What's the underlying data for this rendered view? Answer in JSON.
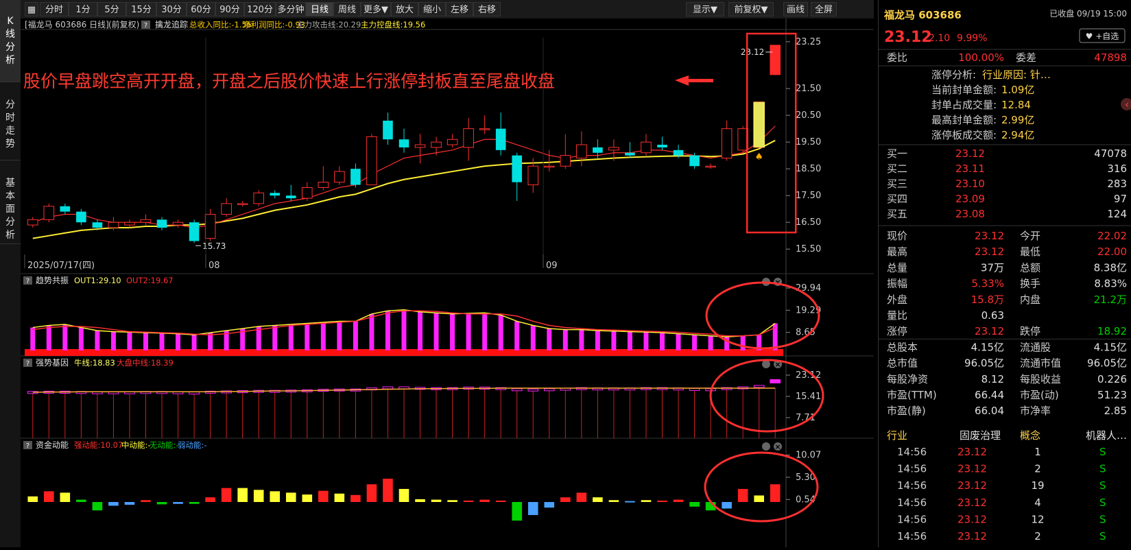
{
  "left_tabs": [
    {
      "label": [
        "K",
        "线",
        "分",
        "析"
      ],
      "active": true
    },
    {
      "label": [
        "分",
        "时",
        "走",
        "势"
      ],
      "active": false
    },
    {
      "label": [
        "基",
        "本",
        "面",
        "分",
        "析"
      ],
      "active": false
    }
  ],
  "toolbar": {
    "periods": [
      "分时",
      "1分",
      "5分",
      "15分",
      "30分",
      "60分",
      "90分",
      "120分",
      "多分钟",
      "日线",
      "周线",
      "更多▼"
    ],
    "active_period": "日线",
    "actions": [
      "放大",
      "缩小",
      "左移",
      "右移"
    ],
    "right": [
      "显示▼",
      "前复权▼",
      "画线",
      "全屏"
    ]
  },
  "main_header": {
    "title": "[福龙马 603686 日线]",
    "adjust": "(前复权)",
    "help": "?",
    "indicator_name": "擒龙追踪",
    "items": [
      {
        "text": "总收入同比:-1.55",
        "color": "#ffcc00"
      },
      {
        "text": "净利润同比:-0.93",
        "color": "#ffcc00"
      },
      {
        "text": "主力攻击线:20.29",
        "color": "#aaaaaa"
      },
      {
        "text": "主力控盘线:19.56",
        "color": "#ffee33"
      }
    ]
  },
  "annotation": {
    "text": "股价早盘跳空高开开盘，开盘之后股价快速上行涨停封板直至尾盘收盘",
    "color": "#ff3b30"
  },
  "price_axis": [
    "23.25",
    "21.50",
    "20.50",
    "19.50",
    "18.50",
    "17.50",
    "16.50",
    "15.50"
  ],
  "price_marks": {
    "high_label": "23.12",
    "low_label": "15.73"
  },
  "x_axis": [
    "2025/07/17(四)",
    "08",
    "09"
  ],
  "sub1": {
    "help": "?",
    "name": "趋势共振",
    "items": [
      {
        "text": "OUT1:29.10",
        "color": "#ffff66"
      },
      {
        "text": "OUT2:19.67",
        "color": "#ff3030"
      }
    ],
    "axis": [
      "29.94",
      "19.29",
      "8.65"
    ]
  },
  "sub2": {
    "help": "?",
    "name": "强势基因",
    "items": [
      {
        "text": "牛线:18.83",
        "color": "#ffff66"
      },
      {
        "text": "大盘中线:18.39",
        "color": "#ff3030"
      }
    ],
    "axis": [
      "23.12",
      "15.41",
      "7.71"
    ]
  },
  "sub3": {
    "help": "?",
    "name": "资金动能",
    "items": [
      {
        "text": "强动能:10.07",
        "color": "#ff3030"
      },
      {
        "text": "中动能:-",
        "color": "#ffff33"
      },
      {
        "text": "无动能:-",
        "color": "#00d000"
      },
      {
        "text": "弱动能:-",
        "color": "#4aa0ff"
      }
    ],
    "axis": [
      "10.07",
      "5.30",
      "0.54"
    ]
  },
  "chart_data": {
    "type": "candlestick",
    "ylim": [
      15.3,
      23.4
    ],
    "candles": [
      {
        "o": 16.4,
        "c": 16.6,
        "h": 16.7,
        "l": 16.3
      },
      {
        "o": 16.6,
        "c": 17.1,
        "h": 17.2,
        "l": 16.5
      },
      {
        "o": 17.1,
        "c": 16.9,
        "h": 17.2,
        "l": 16.8
      },
      {
        "o": 16.9,
        "c": 16.5,
        "h": 17.0,
        "l": 16.4
      },
      {
        "o": 16.5,
        "c": 16.3,
        "h": 16.6,
        "l": 16.2
      },
      {
        "o": 16.3,
        "c": 16.5,
        "h": 16.7,
        "l": 16.2
      },
      {
        "o": 16.4,
        "c": 16.5,
        "h": 16.6,
        "l": 16.3
      },
      {
        "o": 16.5,
        "c": 16.6,
        "h": 16.8,
        "l": 16.4
      },
      {
        "o": 16.6,
        "c": 16.3,
        "h": 16.7,
        "l": 16.2
      },
      {
        "o": 16.4,
        "c": 16.5,
        "h": 16.6,
        "l": 16.3
      },
      {
        "o": 16.5,
        "c": 15.8,
        "h": 16.6,
        "l": 15.73
      },
      {
        "o": 15.9,
        "c": 16.8,
        "h": 17.0,
        "l": 15.8
      },
      {
        "o": 16.8,
        "c": 17.2,
        "h": 17.4,
        "l": 16.7
      },
      {
        "o": 17.2,
        "c": 17.2,
        "h": 17.3,
        "l": 17.1
      },
      {
        "o": 17.2,
        "c": 17.6,
        "h": 17.7,
        "l": 17.1
      },
      {
        "o": 17.6,
        "c": 17.5,
        "h": 17.7,
        "l": 17.4
      },
      {
        "o": 17.5,
        "c": 17.4,
        "h": 17.9,
        "l": 17.3
      },
      {
        "o": 17.4,
        "c": 17.8,
        "h": 18.0,
        "l": 17.3
      },
      {
        "o": 17.8,
        "c": 18.0,
        "h": 18.6,
        "l": 17.7
      },
      {
        "o": 18.0,
        "c": 18.4,
        "h": 18.6,
        "l": 17.9
      },
      {
        "o": 18.5,
        "c": 17.9,
        "h": 18.7,
        "l": 17.8
      },
      {
        "o": 17.9,
        "c": 19.7,
        "h": 19.8,
        "l": 17.9
      },
      {
        "o": 20.3,
        "c": 19.6,
        "h": 20.6,
        "l": 19.4
      },
      {
        "o": 19.6,
        "c": 19.3,
        "h": 20.0,
        "l": 19.1
      },
      {
        "o": 19.3,
        "c": 19.4,
        "h": 19.8,
        "l": 18.7
      },
      {
        "o": 19.3,
        "c": 19.5,
        "h": 19.7,
        "l": 19.0
      },
      {
        "o": 19.4,
        "c": 19.6,
        "h": 19.8,
        "l": 19.3
      },
      {
        "o": 19.3,
        "c": 20.0,
        "h": 20.4,
        "l": 18.8
      },
      {
        "o": 20.0,
        "c": 20.0,
        "h": 20.5,
        "l": 19.8
      },
      {
        "o": 20.0,
        "c": 19.2,
        "h": 20.6,
        "l": 19.0
      },
      {
        "o": 19.0,
        "c": 18.0,
        "h": 19.1,
        "l": 17.3
      },
      {
        "o": 17.9,
        "c": 18.6,
        "h": 18.9,
        "l": 17.6
      },
      {
        "o": 18.6,
        "c": 18.6,
        "h": 19.2,
        "l": 18.4
      },
      {
        "o": 18.6,
        "c": 19.0,
        "h": 19.8,
        "l": 18.5
      },
      {
        "o": 18.9,
        "c": 19.4,
        "h": 19.9,
        "l": 18.6
      },
      {
        "o": 19.3,
        "c": 19.1,
        "h": 19.6,
        "l": 18.9
      },
      {
        "o": 19.2,
        "c": 19.3,
        "h": 19.6,
        "l": 18.8
      },
      {
        "o": 19.1,
        "c": 19.0,
        "h": 19.5,
        "l": 18.9
      },
      {
        "o": 19.1,
        "c": 19.5,
        "h": 19.8,
        "l": 19.0
      },
      {
        "o": 19.4,
        "c": 19.3,
        "h": 19.7,
        "l": 19.2
      },
      {
        "o": 19.2,
        "c": 19.0,
        "h": 19.4,
        "l": 18.9
      },
      {
        "o": 19.0,
        "c": 18.6,
        "h": 19.1,
        "l": 18.5
      },
      {
        "o": 18.6,
        "c": 18.6,
        "h": 18.7,
        "l": 18.5
      },
      {
        "o": 18.9,
        "c": 20.0,
        "h": 20.3,
        "l": 18.8
      },
      {
        "o": 19.2,
        "c": 20.0,
        "h": 20.1,
        "l": 19.1
      },
      {
        "o": 19.3,
        "c": 21.0,
        "h": 21.0,
        "l": 19.3
      },
      {
        "o": 22.02,
        "c": 23.12,
        "h": 23.12,
        "l": 22.0
      }
    ],
    "ma_fast": [
      16.5,
      16.7,
      16.8,
      16.8,
      16.6,
      16.5,
      16.5,
      16.5,
      16.4,
      16.4,
      16.3,
      16.4,
      16.6,
      16.8,
      17.0,
      17.2,
      17.3,
      17.4,
      17.6,
      17.8,
      17.9,
      18.3,
      18.6,
      18.9,
      19.0,
      19.1,
      19.2,
      19.4,
      19.6,
      19.6,
      19.4,
      19.2,
      19.0,
      18.9,
      19.0,
      19.0,
      19.1,
      19.1,
      19.2,
      19.2,
      19.1,
      19.0,
      18.9,
      19.0,
      19.1,
      19.5,
      20.1
    ],
    "ma_slow": [
      15.9,
      16.0,
      16.1,
      16.2,
      16.25,
      16.3,
      16.3,
      16.35,
      16.35,
      16.4,
      16.4,
      16.45,
      16.55,
      16.65,
      16.8,
      16.95,
      17.05,
      17.15,
      17.3,
      17.45,
      17.55,
      17.75,
      17.95,
      18.1,
      18.2,
      18.3,
      18.4,
      18.5,
      18.6,
      18.65,
      18.7,
      18.72,
      18.74,
      18.78,
      18.82,
      18.86,
      18.9,
      18.93,
      18.95,
      18.97,
      18.98,
      18.98,
      18.96,
      18.98,
      19.05,
      19.25,
      19.56
    ],
    "sub1_bars": [
      11,
      12,
      12.5,
      11,
      9.5,
      9,
      8.8,
      8.5,
      8.3,
      8,
      7.5,
      8.5,
      9.5,
      10.5,
      11.5,
      12,
      12.5,
      13,
      13.5,
      14,
      14,
      17.5,
      19,
      19.5,
      18.5,
      18,
      17.5,
      17.8,
      18,
      17,
      14,
      12,
      10.5,
      10,
      10,
      9.5,
      9.3,
      9,
      8.8,
      8.5,
      8,
      7.5,
      7,
      6.5,
      7,
      7.5,
      13,
      29.1
    ],
    "sub1_ma": [
      10,
      11,
      11.5,
      11.5,
      11,
      10,
      9,
      8.8,
      8.5,
      8.3,
      7.8,
      7.5,
      8,
      9,
      10,
      11,
      12,
      12.5,
      13,
      13.5,
      14,
      16,
      18,
      19,
      19,
      18.7,
      18,
      17.5,
      17.5,
      17.5,
      16.5,
      14,
      12,
      11,
      10.5,
      10,
      9.8,
      9.5,
      9.2,
      9,
      8.7,
      8.2,
      7.8,
      7,
      7,
      7.5,
      11,
      19.7
    ],
    "sub2_bars": [
      17.2,
      17.3,
      17.3,
      17.2,
      17.1,
      17.1,
      17.1,
      17.2,
      17.2,
      17.1,
      17.0,
      17.3,
      17.4,
      17.5,
      17.6,
      17.6,
      17.7,
      17.8,
      18.0,
      18.1,
      18.1,
      18.5,
      18.9,
      18.9,
      18.7,
      18.6,
      18.6,
      18.8,
      18.8,
      18.6,
      18.2,
      18.1,
      18.2,
      18.4,
      18.6,
      18.5,
      18.5,
      18.5,
      18.6,
      18.6,
      18.5,
      18.3,
      18.2,
      18.6,
      18.9,
      19.4,
      21.5
    ],
    "sub2_line": [
      16.9,
      17.0,
      17.0,
      17.1,
      17.1,
      17.1,
      17.1,
      17.1,
      17.1,
      17.1,
      17.1,
      17.1,
      17.2,
      17.2,
      17.3,
      17.4,
      17.4,
      17.5,
      17.6,
      17.7,
      17.8,
      17.9,
      18.0,
      18.1,
      18.2,
      18.2,
      18.3,
      18.3,
      18.3,
      18.4,
      18.4,
      18.4,
      18.4,
      18.4,
      18.4,
      18.4,
      18.4,
      18.4,
      18.4,
      18.4,
      18.4,
      18.4,
      18.4,
      18.4,
      18.4,
      18.4,
      18.39
    ],
    "sub3_bars": [
      1.2,
      2.3,
      2.0,
      0.5,
      -1.8,
      -0.8,
      -0.6,
      0.4,
      -0.5,
      -0.4,
      -0.4,
      1.0,
      3.0,
      3.0,
      2.6,
      2.3,
      2.0,
      1.6,
      2.4,
      1.8,
      1.5,
      3.8,
      5.0,
      2.8,
      0.6,
      0.5,
      0.4,
      0.3,
      0.5,
      0.3,
      -4.0,
      -2.8,
      -1.2,
      1.0,
      2.0,
      1.0,
      0.4,
      0.2,
      0.4,
      0.3,
      0.5,
      -1.0,
      -1.8,
      -1.4,
      2.8,
      1.4,
      3.8,
      10.07
    ],
    "sub3_colors": [
      "#ffff33",
      "#ff2020",
      "#ffff33",
      "#00d000",
      "#00d000",
      "#4aa0ff",
      "#4aa0ff",
      "#ff2020",
      "#00d000",
      "#4aa0ff",
      "#00d000",
      "#ff2020",
      "#ff2020",
      "#ffff33",
      "#ffff33",
      "#ffff33",
      "#ffff33",
      "#ffff33",
      "#ff2020",
      "#ffff33",
      "#ff2020",
      "#ff2020",
      "#ff2020",
      "#ffff33",
      "#ffff33",
      "#ffff33",
      "#ffff33",
      "#ff2020",
      "#ff2020",
      "#ff2020",
      "#00d000",
      "#4aa0ff",
      "#4aa0ff",
      "#ff2020",
      "#ff2020",
      "#ffff33",
      "#ffff33",
      "#4aa0ff",
      "#ffff33",
      "#ff2020",
      "#ff2020",
      "#00d000",
      "#00d000",
      "#4aa0ff",
      "#ff2020",
      "#ffff33",
      "#ff2020",
      "#ff2020"
    ]
  },
  "quote": {
    "name_code": "福龙马 603686",
    "status": "已收盘 09/19 15:00",
    "price": "23.12",
    "change": "2.10",
    "pct": "9.99%",
    "watch": "♥ +自选",
    "weibi_label": "委比",
    "weibi": "100.00%",
    "weicha_label": "委差",
    "weicha": "47898",
    "limit_items": [
      {
        "label": "涨停分析:",
        "value": "行业原因: 针…"
      },
      {
        "label": "当前封单金额:",
        "value": "1.09亿"
      },
      {
        "label": "封单占成交量:",
        "value": "12.84"
      },
      {
        "label": "最高封单金额:",
        "value": "2.99亿"
      },
      {
        "label": "涨停板成交额:",
        "value": "2.94亿"
      }
    ],
    "bids": [
      {
        "label": "买一",
        "price": "23.12",
        "vol": "47078"
      },
      {
        "label": "买二",
        "price": "23.11",
        "vol": "316"
      },
      {
        "label": "买三",
        "price": "23.10",
        "vol": "283"
      },
      {
        "label": "买四",
        "price": "23.09",
        "vol": "97"
      },
      {
        "label": "买五",
        "price": "23.08",
        "vol": "124"
      }
    ],
    "stats": [
      [
        {
          "label": "现价",
          "value": "23.12",
          "color": "#ff3030"
        },
        {
          "label": "今开",
          "value": "22.02",
          "color": "#ff3030"
        }
      ],
      [
        {
          "label": "最高",
          "value": "23.12",
          "color": "#ff3030"
        },
        {
          "label": "最低",
          "value": "22.00",
          "color": "#ff3030"
        }
      ],
      [
        {
          "label": "总量",
          "value": "37万",
          "color": "#e0e0e0"
        },
        {
          "label": "总额",
          "value": "8.38亿",
          "color": "#e0e0e0"
        }
      ],
      [
        {
          "label": "振幅",
          "value": "5.33%",
          "color": "#ff3030"
        },
        {
          "label": "换手",
          "value": "8.83%",
          "color": "#e0e0e0"
        }
      ],
      [
        {
          "label": "外盘",
          "value": "15.8万",
          "color": "#ff3030"
        },
        {
          "label": "内盘",
          "value": "21.2万",
          "color": "#00d000"
        }
      ],
      [
        {
          "label": "量比",
          "value": "0.63",
          "color": "#e0e0e0"
        },
        {
          "label": "",
          "value": "",
          "color": "#e0e0e0"
        }
      ],
      [
        {
          "label": "涨停",
          "value": "23.12",
          "color": "#ff3030"
        },
        {
          "label": "跌停",
          "value": "18.92",
          "color": "#00d000"
        }
      ],
      [
        {
          "label": "总股本",
          "value": "4.15亿",
          "color": "#e0e0e0"
        },
        {
          "label": "流通股",
          "value": "4.15亿",
          "color": "#e0e0e0"
        }
      ],
      [
        {
          "label": "总市值",
          "value": "96.05亿",
          "color": "#e0e0e0"
        },
        {
          "label": "流通市值",
          "value": "96.05亿",
          "color": "#e0e0e0"
        }
      ],
      [
        {
          "label": "每股净资",
          "value": "8.12",
          "color": "#e0e0e0"
        },
        {
          "label": "每股收益",
          "value": "0.226",
          "color": "#e0e0e0"
        }
      ],
      [
        {
          "label": "市盈(TTM)",
          "value": "66.44",
          "color": "#e0e0e0"
        },
        {
          "label": "市盈(动)",
          "value": "51.23",
          "color": "#e0e0e0"
        }
      ],
      [
        {
          "label": "市盈(静)",
          "value": "66.04",
          "color": "#e0e0e0"
        },
        {
          "label": "市净率",
          "value": "2.85",
          "color": "#e0e0e0"
        }
      ]
    ],
    "industry": {
      "label1": "行业",
      "value1": "固废治理",
      "label2": "概念",
      "value2": "机器人…"
    },
    "ticks": [
      {
        "time": "14:56",
        "price": "23.12",
        "vol": "1",
        "side": "S"
      },
      {
        "time": "14:56",
        "price": "23.12",
        "vol": "2",
        "side": "S"
      },
      {
        "time": "14:56",
        "price": "23.12",
        "vol": "19",
        "side": "S"
      },
      {
        "time": "14:56",
        "price": "23.12",
        "vol": "4",
        "side": "S"
      },
      {
        "time": "14:56",
        "price": "23.12",
        "vol": "12",
        "side": "S"
      },
      {
        "time": "14:56",
        "price": "23.12",
        "vol": "2",
        "side": "S"
      }
    ]
  }
}
